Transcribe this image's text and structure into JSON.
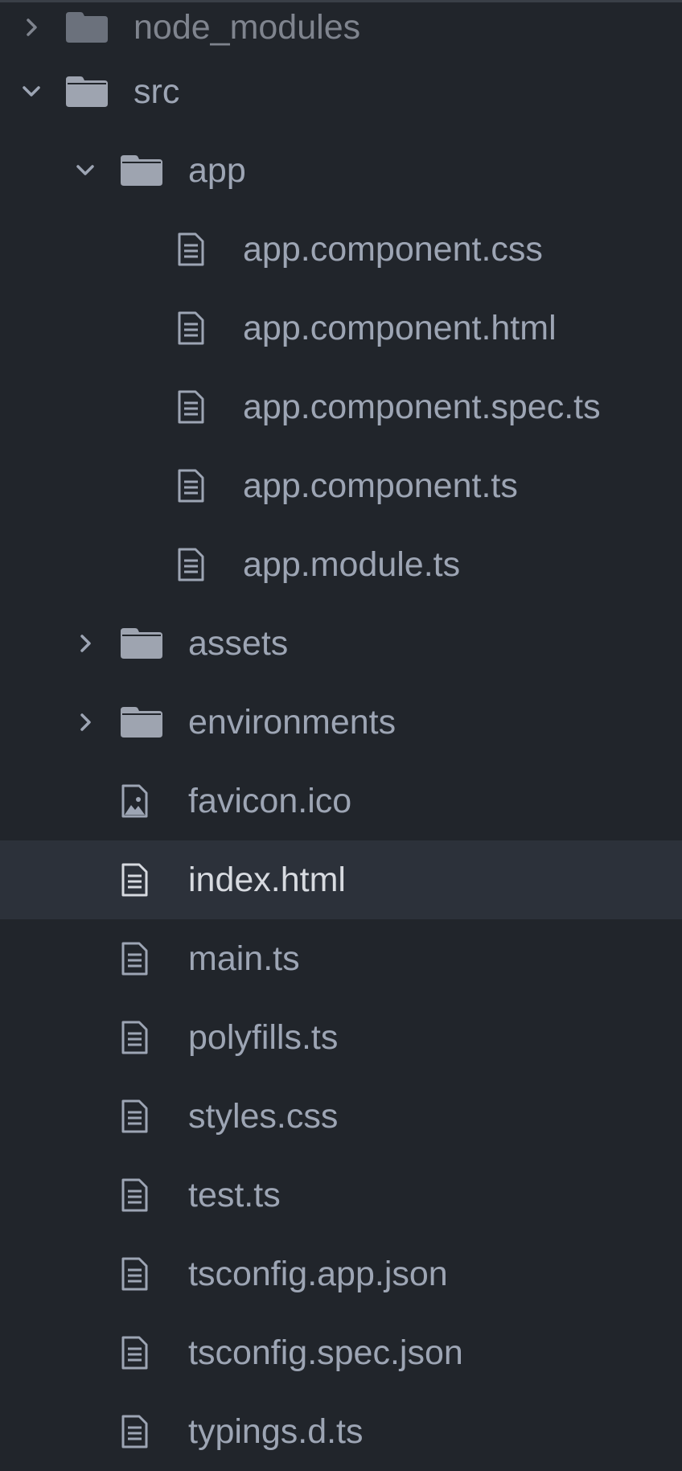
{
  "explorer": {
    "items": [
      {
        "label": "node_modules",
        "kind": "folder",
        "icon": "folder-icon",
        "expanded": false
      },
      {
        "label": "src",
        "kind": "folder",
        "icon": "folder-icon",
        "expanded": true
      },
      {
        "label": "app",
        "kind": "folder",
        "icon": "folder-icon",
        "expanded": true
      },
      {
        "label": "app.component.css",
        "kind": "file",
        "icon": "file-text-icon"
      },
      {
        "label": "app.component.html",
        "kind": "file",
        "icon": "file-text-icon"
      },
      {
        "label": "app.component.spec.ts",
        "kind": "file",
        "icon": "file-text-icon"
      },
      {
        "label": "app.component.ts",
        "kind": "file",
        "icon": "file-text-icon"
      },
      {
        "label": "app.module.ts",
        "kind": "file",
        "icon": "file-text-icon"
      },
      {
        "label": "assets",
        "kind": "folder",
        "icon": "folder-icon",
        "expanded": false
      },
      {
        "label": "environments",
        "kind": "folder",
        "icon": "folder-icon",
        "expanded": false
      },
      {
        "label": "favicon.ico",
        "kind": "file",
        "icon": "file-image-icon"
      },
      {
        "label": "index.html",
        "kind": "file",
        "icon": "file-text-icon",
        "selected": true
      },
      {
        "label": "main.ts",
        "kind": "file",
        "icon": "file-text-icon"
      },
      {
        "label": "polyfills.ts",
        "kind": "file",
        "icon": "file-text-icon"
      },
      {
        "label": "styles.css",
        "kind": "file",
        "icon": "file-text-icon"
      },
      {
        "label": "test.ts",
        "kind": "file",
        "icon": "file-text-icon"
      },
      {
        "label": "tsconfig.app.json",
        "kind": "file",
        "icon": "file-text-icon"
      },
      {
        "label": "tsconfig.spec.json",
        "kind": "file",
        "icon": "file-text-icon"
      },
      {
        "label": "typings.d.ts",
        "kind": "file",
        "icon": "file-text-icon"
      }
    ]
  },
  "colors": {
    "background": "#21252b",
    "selected_row": "#2c313a",
    "text": "#9da5b4",
    "icon": "#9da5b4"
  }
}
